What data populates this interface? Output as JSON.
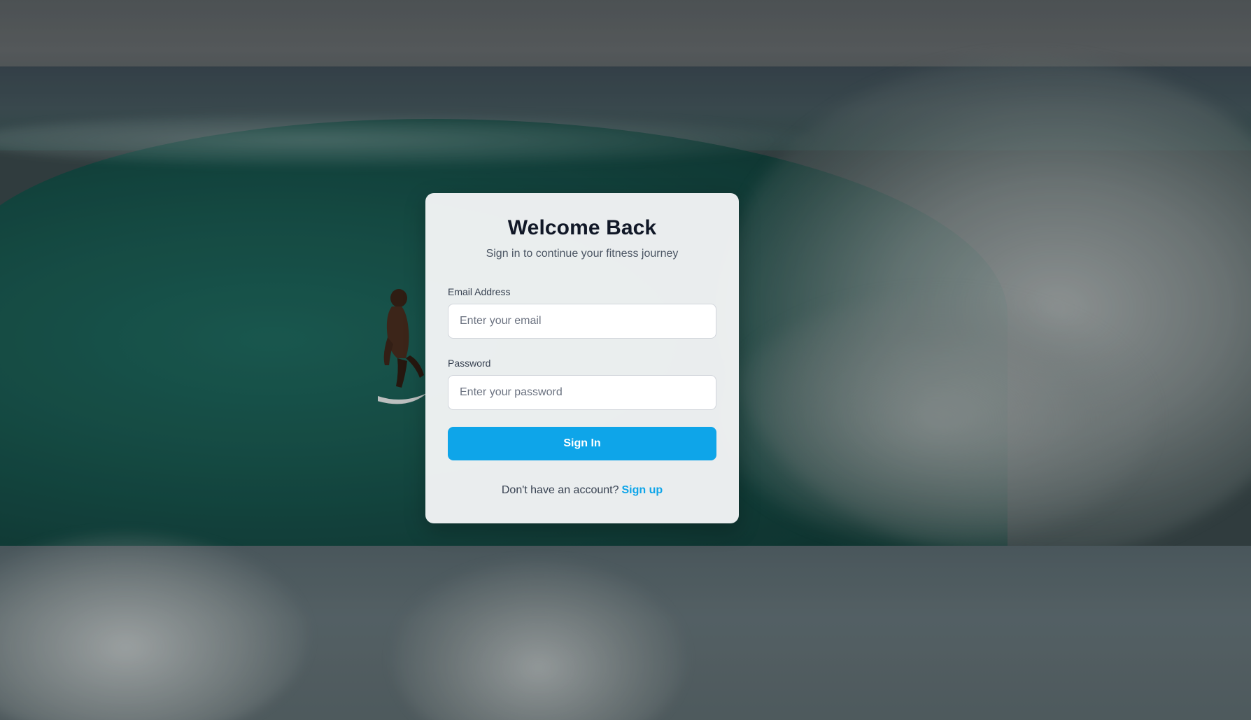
{
  "login": {
    "title": "Welcome Back",
    "subtitle": "Sign in to continue your fitness journey",
    "email": {
      "label": "Email Address",
      "placeholder": "Enter your email",
      "value": ""
    },
    "password": {
      "label": "Password",
      "placeholder": "Enter your password",
      "value": ""
    },
    "submit_label": "Sign In",
    "signup_prompt": "Don't have an account?",
    "signup_link": "Sign up"
  },
  "colors": {
    "accent": "#0ea5e9",
    "title": "#111827",
    "card_background": "#f4f5f6"
  }
}
